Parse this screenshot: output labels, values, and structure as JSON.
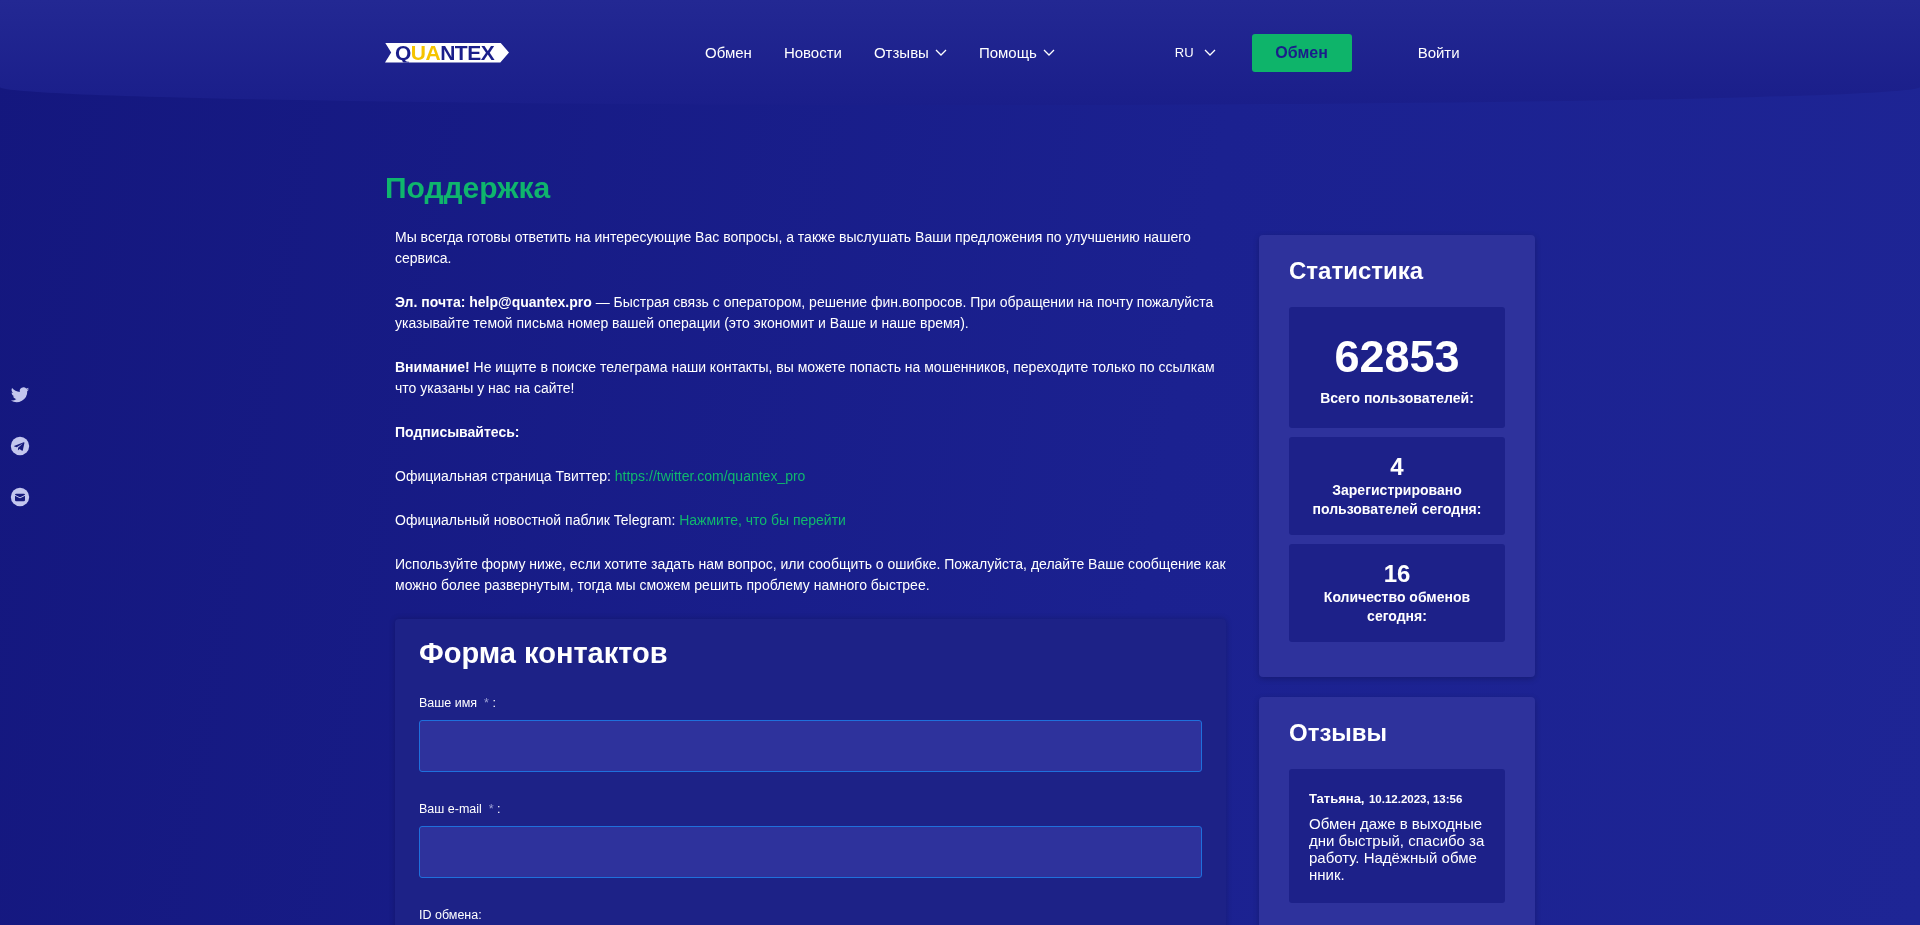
{
  "header": {
    "logo": [
      {
        "text": "Q",
        "accent": false
      },
      {
        "text": "UA",
        "accent": true
      },
      {
        "text": "NTEX",
        "accent": false
      }
    ],
    "nav": [
      {
        "label": "Обмен",
        "dropdown": false
      },
      {
        "label": "Новости",
        "dropdown": false
      },
      {
        "label": "Отзывы",
        "dropdown": true
      },
      {
        "label": "Помощь",
        "dropdown": true
      }
    ],
    "language": "RU",
    "exchange_button": "Обмен",
    "login": "Войти"
  },
  "social": [
    {
      "kind": "twitter"
    },
    {
      "kind": "telegram"
    },
    {
      "kind": "mail"
    }
  ],
  "title": "Поддержка",
  "paragraphs": [
    {
      "text": "Мы всегда готовы ответить на интересующие Вас вопросы, а также выслушать Ваши предложения по улучшению нашего сервиса."
    },
    {
      "text": "**Эл. почта: help@quantex.pro** — Быстрая связь с оператором, решение фин.вопросов. При обращении на почту пожалуйста указывайте темой письма номер вашей операции (это экономит и Ваше и наше время)."
    },
    {
      "text": "**Внимание!** Не ищите в поиске телеграма наши контакты, вы можете попасть на мошенников, переходите только по ссылкам что указаны у нас на сайте!"
    },
    {
      "text": "**Подписывайтесь:**"
    },
    {
      "text": "Официальная страница Твиттер: ",
      "link": "https://twitter.com/quantex_pro"
    },
    {
      "text": "Официальный новостной паблик Telegram: ",
      "link": "Нажмите, что бы перейти"
    },
    {
      "text": "Используйте форму ниже, если хотите задать нам вопрос, или сообщить о ошибке. Пожалуйста, делайте Ваше сообщение как можно более развернутым, тогда мы сможем решить проблему намного быстрее."
    }
  ],
  "form": {
    "title": "Форма контактов",
    "fields": [
      {
        "label": "Ваше имя",
        "required_mark": "*",
        "separator": ":"
      },
      {
        "label": "Ваш e-mail",
        "required_mark": "*",
        "separator": ":"
      },
      {
        "label": "ID обмена:"
      }
    ]
  },
  "stats": {
    "title": "Статистика",
    "items": [
      {
        "value": "62853",
        "label": "Всего пользователей:",
        "big": true
      },
      {
        "value": "4",
        "label": "Зарегистрировано пользователей сегодня:",
        "big": false
      },
      {
        "value": "16",
        "label": "Количество обменов сегодня:",
        "big": false
      }
    ]
  },
  "reviews": {
    "title": "Отзывы",
    "items": [
      {
        "author": "Татьяна,",
        "date": "10.12.2023, 13:56",
        "text": "Обмен даже в выходные дни быстрый, спасибо за работу. Надёжный обменник."
      }
    ]
  }
}
